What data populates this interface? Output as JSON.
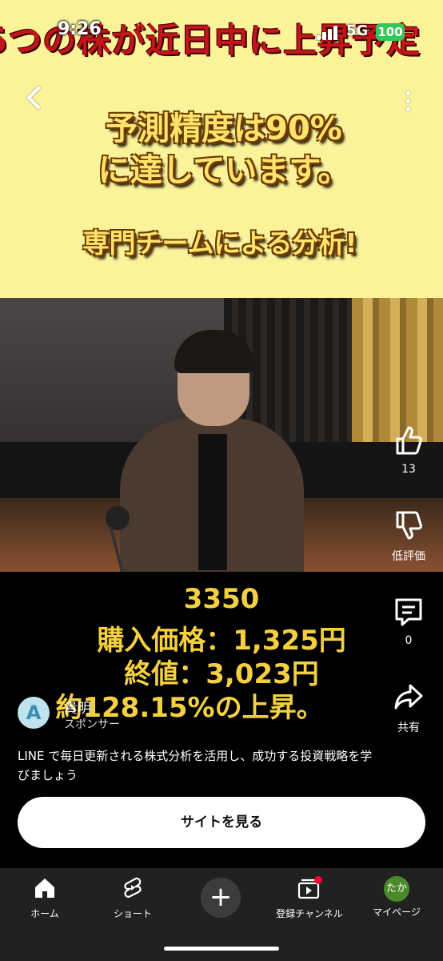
{
  "status_bar": {
    "time": "9:26",
    "network": "5G",
    "battery": "100"
  },
  "ad": {
    "banner": "5つの株が近日中に上昇予定",
    "headline_line1": "予測精度は90%",
    "headline_line2": "に達しています。",
    "headline_line3": "専門チームによる分析!"
  },
  "overlay": {
    "line1": "3350",
    "line2": "購入価格：1,325円",
    "line3": "終値：3,023円",
    "line4": "約128.15%の上昇。"
  },
  "actions": {
    "like_count": "13",
    "dislike_label": "低評価",
    "comments_count": "0",
    "share_label": "共有"
  },
  "sponsor": {
    "avatar_letter": "A",
    "channel_name": "貴明",
    "label": "スポンサー",
    "description": "LINE で毎日更新される株式分析を活用し、成功する投資戦略を学びましょう",
    "cta_label": "サイトを見る"
  },
  "nav": {
    "home": "ホーム",
    "shorts": "ショート",
    "subscriptions": "登録チャンネル",
    "me": "マイページ",
    "me_avatar": "たか"
  },
  "colors": {
    "ad_background": "#fbf39a",
    "overlay_text": "#f4d03f",
    "nav_background": "#212121"
  }
}
